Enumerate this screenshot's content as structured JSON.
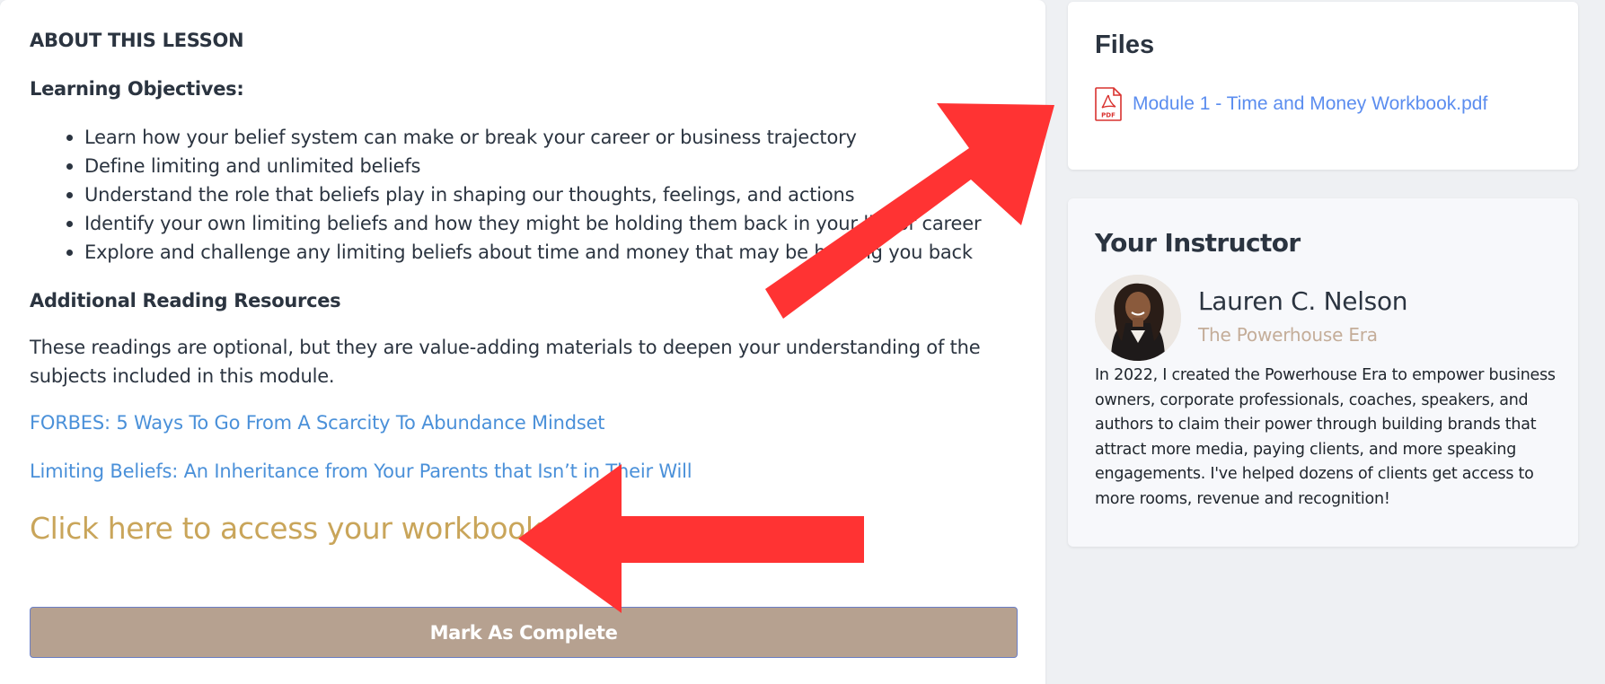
{
  "lesson": {
    "about_heading": "ABOUT THIS LESSON",
    "objectives_heading": "Learning Objectives:",
    "objectives": [
      "Learn how your belief system can make or break your career or business trajectory",
      "Define limiting and unlimited beliefs",
      "Understand the role that beliefs play in shaping our thoughts, feelings, and actions",
      "Identify your own limiting beliefs and how they might be holding them back in your life or career",
      "Explore and challenge any limiting beliefs about time and money that may be holding you back"
    ],
    "resources_heading": "Additional Reading Resources",
    "resources_paragraph": "These readings are optional, but they are value-adding materials to deepen your understanding of the subjects included in this module.",
    "links": [
      "FORBES: 5 Ways To Go From A Scarcity To Abundance Mindset",
      "Limiting Beliefs: An Inheritance from Your Parents that Isn’t in Their Will"
    ],
    "workbook_link": "Click here to access your workbook",
    "complete_button": "Mark As Complete"
  },
  "files": {
    "title": "Files",
    "items": [
      {
        "name": "Module 1 - Time and Money Workbook.pdf",
        "icon": "pdf-file-icon",
        "icon_label": "PDF"
      }
    ]
  },
  "instructor": {
    "title": "Your Instructor",
    "name": "Lauren C. Nelson",
    "company": "The Powerhouse Era",
    "bio": "In 2022, I created the Powerhouse Era to empower business owners, corporate professionals, coaches, speakers, and authors to claim their power through building brands that attract more media, paying clients, and more speaking engagements. I've helped dozens of clients get access to more rooms, revenue and recognition!"
  },
  "colors": {
    "link": "#4a90d9",
    "workbook_link": "#c9a55a",
    "button_bg": "#b6a190",
    "annotation_arrow": "#ff3333",
    "company": "#c4ad99",
    "file_link": "#5b8def"
  }
}
